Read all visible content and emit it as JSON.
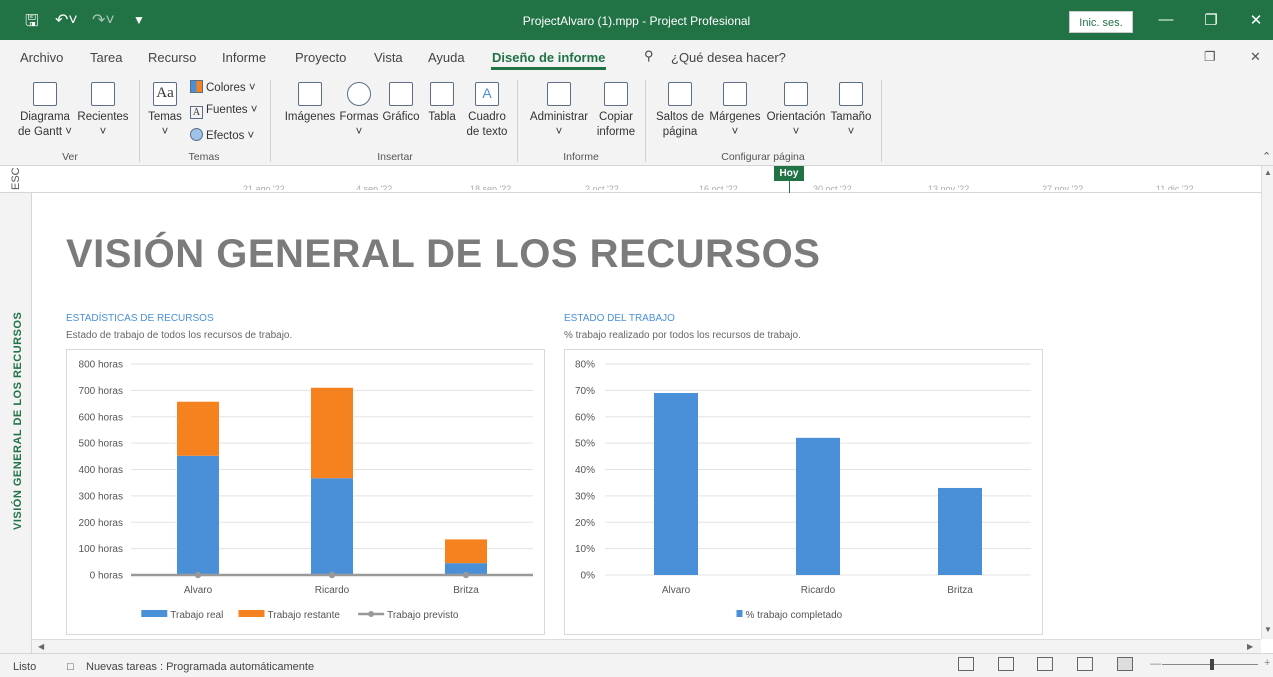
{
  "window": {
    "title": "ProjectAlvaro (1).mpp  -  Project Profesional",
    "signin_label": "Inic. ses.",
    "qat_icons": [
      "save-icon",
      "undo-icon",
      "redo-icon",
      "customize-icon"
    ]
  },
  "menu": {
    "tabs": [
      "Archivo",
      "Tarea",
      "Recurso",
      "Informe",
      "Proyecto",
      "Vista",
      "Ayuda",
      "Diseño de informe"
    ],
    "active_tab": "Diseño de informe",
    "search_placeholder": "¿Qué desea hacer?"
  },
  "ribbon": {
    "groups": {
      "ver": "Ver",
      "temas": "Temas",
      "insertar": "Insertar",
      "informe": "Informe",
      "configurar": "Configurar página"
    },
    "buttons": {
      "gantt_line1": "Diagrama",
      "gantt_line2": "de Gantt ˅",
      "recientes": "Recientes",
      "temas": "Temas",
      "colores": "Colores ˅",
      "fuentes": "Fuentes ˅",
      "efectos": "Efectos ˅",
      "imagenes": "Imágenes",
      "formas": "Formas",
      "grafico": "Gráfico",
      "tabla": "Tabla",
      "cuadro_line1": "Cuadro",
      "cuadro_line2": "de texto",
      "administrar": "Administrar",
      "copiar_line1": "Copiar",
      "copiar_line2": "informe",
      "saltos_line1": "Saltos de",
      "saltos_line2": "página",
      "margenes": "Márgenes",
      "orientacion": "Orientación",
      "tamano": "Tamaño"
    }
  },
  "timeline": {
    "side_label": "ESC",
    "today_label": "Hoy",
    "dates": [
      "21 ago '22",
      "4 sep '22",
      "18 sep '22",
      "2 oct '22",
      "16 oct '22",
      "30 oct '22",
      "13 nov '22",
      "27 nov '22",
      "11 dic '22"
    ]
  },
  "report": {
    "side_label": "VISIÓN GENERAL DE LOS RECURSOS",
    "title": "VISIÓN GENERAL DE LOS RECURSOS"
  },
  "chart_data": [
    {
      "type": "bar",
      "stacked": true,
      "title": "ESTADÍSTICAS DE RECURSOS",
      "subtitle": "Estado de trabajo de todos los recursos de trabajo.",
      "categories": [
        "Alvaro",
        "Ricardo",
        "Britza"
      ],
      "y_ticks": [
        "0 horas",
        "100 horas",
        "200 horas",
        "300 horas",
        "400 horas",
        "500 horas",
        "600 horas",
        "700 horas",
        "800 horas"
      ],
      "ylim": [
        0,
        800
      ],
      "grid": true,
      "legend_position": "bottom",
      "series": [
        {
          "name": "Trabajo real",
          "kind": "bar",
          "color": "#4a90d9",
          "values": [
            452,
            367,
            45
          ]
        },
        {
          "name": "Trabajo restante",
          "kind": "bar",
          "color": "#f5821f",
          "values": [
            205,
            343,
            90
          ]
        },
        {
          "name": "Trabajo previsto",
          "kind": "line",
          "color": "#999999",
          "values": [
            0,
            0,
            0
          ]
        }
      ]
    },
    {
      "type": "bar",
      "title": "ESTADO DEL TRABAJO",
      "subtitle": "% trabajo realizado por todos los recursos de trabajo.",
      "categories": [
        "Alvaro",
        "Ricardo",
        "Britza"
      ],
      "y_ticks": [
        "0%",
        "10%",
        "20%",
        "30%",
        "40%",
        "50%",
        "60%",
        "70%",
        "80%"
      ],
      "ylim": [
        0,
        80
      ],
      "grid": true,
      "legend_position": "bottom",
      "series": [
        {
          "name": "% trabajo completado",
          "color": "#4a90d9",
          "values": [
            69,
            52,
            33
          ]
        }
      ]
    }
  ],
  "status": {
    "ready": "Listo",
    "new_tasks": "Nuevas tareas : Programada automáticamente"
  }
}
